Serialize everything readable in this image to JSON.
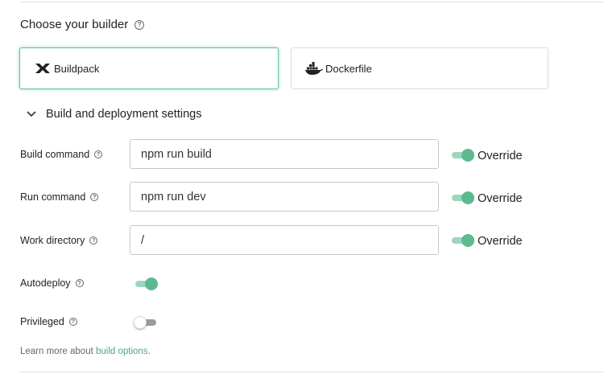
{
  "builder": {
    "title": "Choose your builder",
    "options": [
      {
        "label": "Buildpack",
        "icon": "buildpack-icon",
        "selected": true
      },
      {
        "label": "Dockerfile",
        "icon": "docker-icon",
        "selected": false
      }
    ]
  },
  "settings": {
    "expander_label": "Build and deployment settings",
    "expanded": true,
    "build_command": {
      "label": "Build command",
      "value": "npm run build",
      "override_label": "Override",
      "override_on": true
    },
    "run_command": {
      "label": "Run command",
      "value": "npm run dev",
      "override_label": "Override",
      "override_on": true
    },
    "work_directory": {
      "label": "Work directory",
      "value": "/",
      "override_label": "Override",
      "override_on": true
    },
    "autodeploy": {
      "label": "Autodeploy",
      "on": true
    },
    "privileged": {
      "label": "Privileged",
      "on": false
    }
  },
  "footer": {
    "prefix": "Learn more about ",
    "link": "build options",
    "suffix": "."
  },
  "colors": {
    "accent": "#5fb98f",
    "accent_light": "#9dd6bd",
    "border": "#c8c8c8"
  }
}
